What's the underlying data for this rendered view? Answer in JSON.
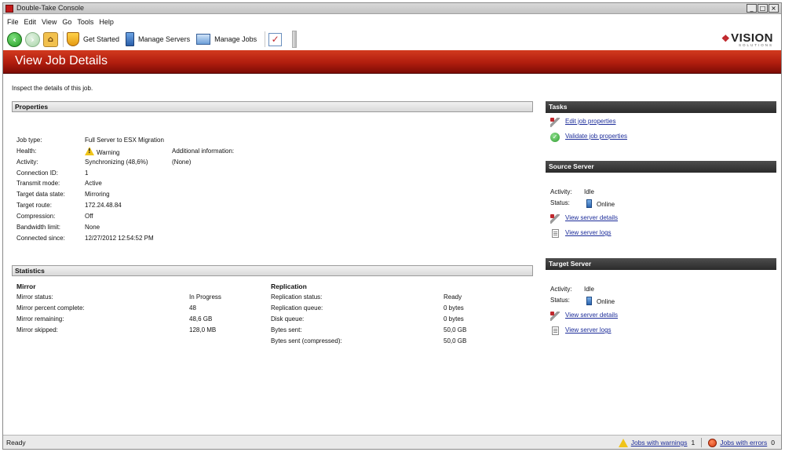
{
  "window": {
    "title": "Double-Take Console",
    "controls": [
      "_",
      "□",
      "×"
    ]
  },
  "menu": [
    "File",
    "Edit",
    "View",
    "Go",
    "Tools",
    "Help"
  ],
  "toolbar": {
    "get_started": "Get Started",
    "manage_servers": "Manage Servers",
    "manage_jobs": "Manage Jobs",
    "logo_text": "VISION",
    "logo_sub": "SOLUTIONS"
  },
  "page": {
    "title": "View Job Details",
    "intro": "Inspect the details of this job."
  },
  "properties": {
    "header": "Properties",
    "rows": [
      {
        "label": "Job type:",
        "value": "Full Server to ESX Migration"
      },
      {
        "label": "Health:",
        "value": "Warning"
      },
      {
        "label": "Activity:",
        "value": "Synchronizing (48,6%)"
      },
      {
        "label": "Connection ID:",
        "value": "1"
      },
      {
        "label": "Transmit mode:",
        "value": "Active"
      },
      {
        "label": "Target data state:",
        "value": "Mirroring"
      },
      {
        "label": "Target route:",
        "value": "172.24.48.84"
      },
      {
        "label": "Compression:",
        "value": "Off"
      },
      {
        "label": "Bandwidth limit:",
        "value": "None"
      },
      {
        "label": "Connected since:",
        "value": "12/27/2012 12:54:52 PM"
      }
    ],
    "additional_label": "Additional information:",
    "additional_value": "(None)"
  },
  "statistics": {
    "header": "Statistics",
    "mirror": {
      "title": "Mirror",
      "rows": [
        {
          "label": "Mirror status:",
          "value": "In Progress"
        },
        {
          "label": "Mirror percent complete:",
          "value": "48"
        },
        {
          "label": "Mirror remaining:",
          "value": "48,6 GB"
        },
        {
          "label": "Mirror skipped:",
          "value": "128,0 MB"
        }
      ]
    },
    "replication": {
      "title": "Replication",
      "rows": [
        {
          "label": "Replication status:",
          "value": "Ready"
        },
        {
          "label": "Replication queue:",
          "value": "0 bytes"
        },
        {
          "label": "Disk queue:",
          "value": "0 bytes"
        },
        {
          "label": "Bytes sent:",
          "value": "50,0 GB"
        },
        {
          "label": "Bytes sent (compressed):",
          "value": "50,0 GB"
        }
      ]
    }
  },
  "tasks": {
    "header": "Tasks",
    "items": [
      "Edit job properties",
      "Validate job properties"
    ]
  },
  "source_server": {
    "header": "Source Server",
    "activity_label": "Activity:",
    "activity": "Idle",
    "status_label": "Status:",
    "status": "Online",
    "links": [
      "View server details",
      "View server logs"
    ]
  },
  "target_server": {
    "header": "Target Server",
    "activity_label": "Activity:",
    "activity": "Idle",
    "status_label": "Status:",
    "status": "Online",
    "links": [
      "View server details",
      "View server logs"
    ]
  },
  "statusbar": {
    "ready": "Ready",
    "warnings_label": "Jobs with warnings",
    "warnings_count": "1",
    "errors_label": "Jobs with errors",
    "errors_count": "0"
  },
  "colors": {
    "banner": "#b11d0e",
    "link": "#1d2d9a",
    "side_header": "#2b2b2b"
  }
}
